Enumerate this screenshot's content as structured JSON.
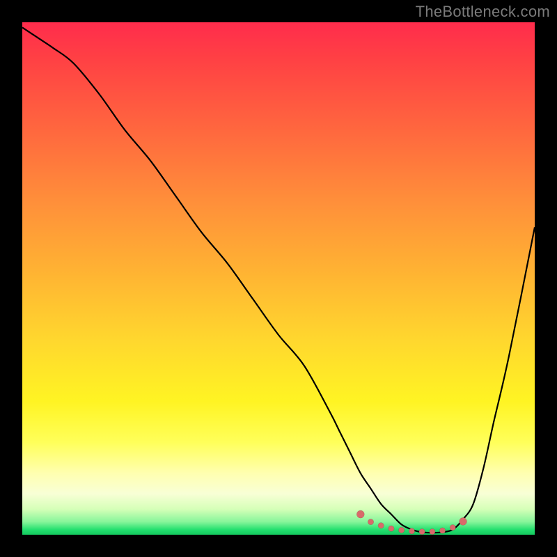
{
  "watermark": "TheBottleneck.com",
  "colors": {
    "background": "#000000",
    "curve": "#000000",
    "dots": "#d86a6a"
  },
  "chart_data": {
    "type": "line",
    "title": "",
    "xlabel": "",
    "ylabel": "",
    "xlim": [
      0,
      100
    ],
    "ylim": [
      0,
      100
    ],
    "grid": false,
    "series": [
      {
        "name": "bottleneck-curve",
        "x": [
          0,
          3,
          6,
          10,
          15,
          20,
          25,
          30,
          35,
          40,
          45,
          50,
          55,
          60,
          62,
          64,
          66,
          68,
          70,
          72,
          74,
          76,
          78,
          80,
          82,
          84,
          86,
          88,
          90,
          92,
          95,
          100
        ],
        "y": [
          99,
          97,
          95,
          92,
          86,
          79,
          73,
          66,
          59,
          53,
          46,
          39,
          33,
          24,
          20,
          16,
          12,
          9,
          6,
          4,
          2,
          1,
          0.5,
          0.4,
          0.5,
          1,
          3,
          6,
          13,
          22,
          35,
          60
        ]
      }
    ],
    "marker_points": {
      "name": "highlight-dots",
      "x": [
        66,
        68,
        70,
        72,
        74,
        76,
        78,
        80,
        82,
        84,
        86
      ],
      "y": [
        4,
        2.5,
        1.8,
        1.2,
        0.9,
        0.7,
        0.6,
        0.6,
        0.8,
        1.4,
        2.6
      ]
    }
  }
}
